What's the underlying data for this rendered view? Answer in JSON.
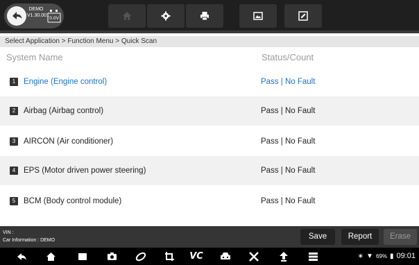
{
  "header": {
    "demo_line1": "DEMO",
    "demo_line2": "V1.30.001",
    "vci_label": "0.0V"
  },
  "breadcrumb": "Select Application > Function Menu > Quick Scan",
  "table": {
    "columns": [
      "System Name",
      "Status/Count"
    ],
    "rows": [
      {
        "num": "1",
        "name": "Engine (Engine control)",
        "status": "Pass | No Fault"
      },
      {
        "num": "2",
        "name": "Airbag (Airbag control)",
        "status": "Pass | No Fault"
      },
      {
        "num": "3",
        "name": "AIRCON (Air conditioner)",
        "status": "Pass | No Fault"
      },
      {
        "num": "4",
        "name": "EPS (Motor driven power steering)",
        "status": "Pass | No Fault"
      },
      {
        "num": "5",
        "name": "BCM (Body control module)",
        "status": "Pass | No Fault"
      }
    ]
  },
  "footer": {
    "vin_label": "VIN :",
    "car_info": "Car Information : DEMO",
    "save": "Save",
    "report": "Report",
    "erase": "Erase"
  },
  "system_bar": {
    "vci_text": "VC",
    "battery": "69%",
    "time": "09:01"
  },
  "colors": {
    "accent": "#1a73c9",
    "topbar": "#1f1f1f",
    "bottom_bar": "#353535"
  }
}
